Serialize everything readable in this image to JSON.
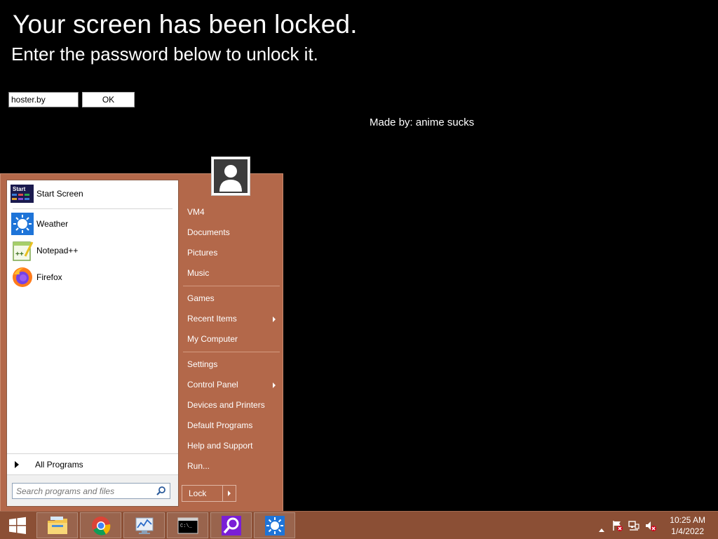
{
  "lock": {
    "title": "Your screen has been locked.",
    "subtitle": "Enter the password below to unlock it.",
    "password_value": "hoster.by",
    "ok_label": "OK",
    "made_by": "Made by: anime sucks"
  },
  "start_menu": {
    "programs": [
      {
        "label": "Start Screen",
        "icon": "start-screen-icon"
      },
      {
        "label": "Weather",
        "icon": "weather-icon"
      },
      {
        "label": "Notepad++",
        "icon": "notepadpp-icon"
      },
      {
        "label": "Firefox",
        "icon": "firefox-icon"
      }
    ],
    "start_screen_icon_text": "Start",
    "all_programs": "All Programs",
    "search_placeholder": "Search programs and files",
    "right_items": {
      "vm4": "VM4",
      "documents": "Documents",
      "pictures": "Pictures",
      "music": "Music",
      "games": "Games",
      "recent_items": "Recent Items",
      "my_computer": "My Computer",
      "settings": "Settings",
      "control_panel": "Control Panel",
      "devices_printers": "Devices and Printers",
      "default_programs": "Default Programs",
      "help_support": "Help and Support",
      "run": "Run..."
    },
    "lock_label": "Lock"
  },
  "taskbar": {
    "apps": [
      "file-explorer-icon",
      "chrome-icon",
      "performance-monitor-icon",
      "command-prompt-icon",
      "search-tool-icon",
      "weather-icon"
    ],
    "time": "10:25 AM",
    "date": "1/4/2022"
  },
  "colors": {
    "accent": "#b3684a",
    "taskbar": "#8b4f35",
    "background": "#000000"
  }
}
